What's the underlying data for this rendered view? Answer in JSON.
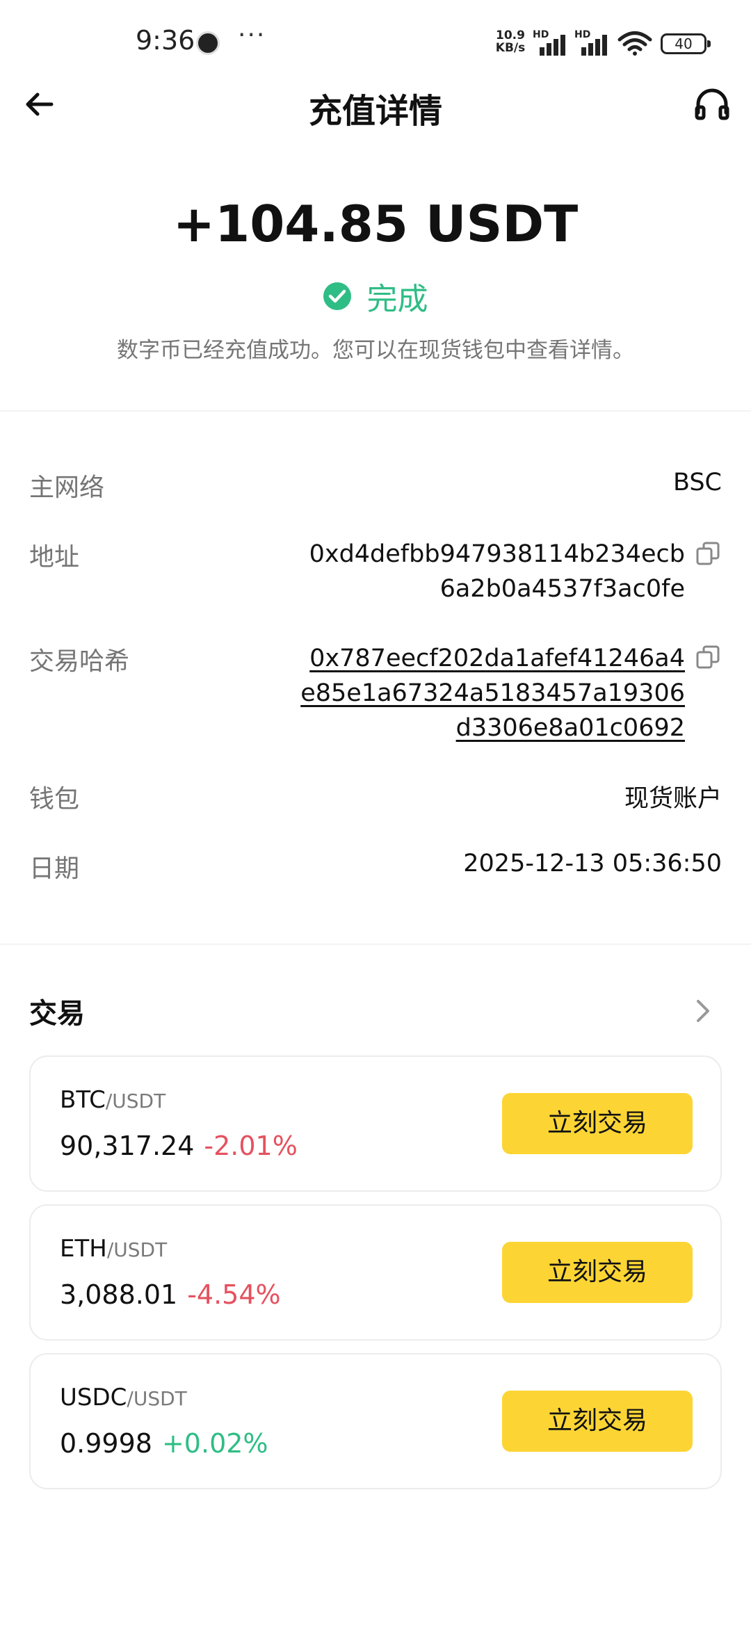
{
  "status_bar": {
    "time": "9:36",
    "more": "···",
    "speed_value": "10.9",
    "speed_unit": "KB/s",
    "sim1_tag": "HD",
    "sim2_tag": "HD",
    "battery": "40"
  },
  "header": {
    "title": "充值详情"
  },
  "summary": {
    "amount": "+104.85 USDT",
    "status": "完成",
    "description": "数字币已经充值成功。您可以在现货钱包中查看详情。"
  },
  "details": {
    "network_label": "主网络",
    "network_value": "BSC",
    "address_label": "地址",
    "address_lines": [
      "0xd4defbb947938114b234ecb",
      "6a2b0a4537f3ac0fe"
    ],
    "txhash_label": "交易哈希",
    "txhash_lines": [
      "0x787eecf202da1afef41246a4",
      "e85e1a67324a5183457a19306",
      "d3306e8a01c0692"
    ],
    "wallet_label": "钱包",
    "wallet_value": "现货账户",
    "date_label": "日期",
    "date_value": "2025-12-13 05:36:50"
  },
  "trade": {
    "title": "交易",
    "cards": [
      {
        "base": "BTC",
        "quote": "/USDT",
        "price": "90,317.24",
        "change": "-2.01%",
        "button": "立刻交易"
      },
      {
        "base": "ETH",
        "quote": "/USDT",
        "price": "3,088.01",
        "change": "-4.54%",
        "button": "立刻交易"
      },
      {
        "base": "USDC",
        "quote": "/USDT",
        "price": "0.9998",
        "change": "+0.02%",
        "button": "立刻交易"
      }
    ]
  },
  "colors": {
    "success_green": "#2ebd85",
    "loss_red": "#e5515f",
    "accent_yellow": "#fcd535"
  }
}
